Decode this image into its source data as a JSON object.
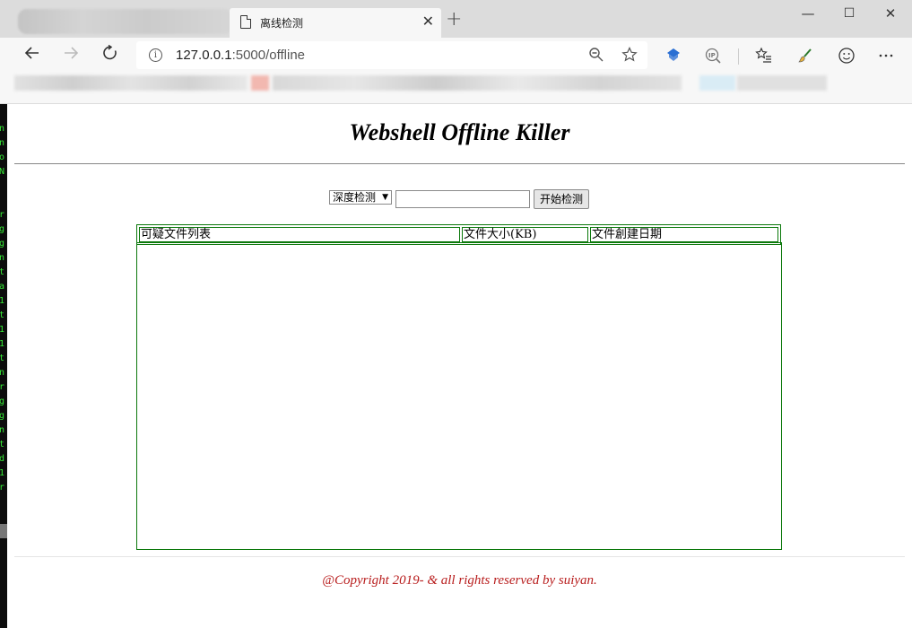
{
  "browser": {
    "active_tab_title": "离线检测",
    "tab_close_glyph": "✕",
    "new_tab_glyph": "+",
    "window_controls": {
      "minimize": "—",
      "maximize": "☐",
      "close": "✕"
    },
    "url_host": "127.0.0.1",
    "url_rest": ":5000/offline",
    "icons": {
      "back": "back-arrow-icon",
      "forward": "forward-arrow-icon",
      "refresh": "refresh-icon",
      "site_info": "info-icon",
      "zoom": "zoom-icon",
      "favorite": "star-icon",
      "favorites_list": "favorites-icon",
      "emoji": "smiley-icon",
      "more": "more-icon"
    }
  },
  "terminal_strip": {
    "lines": [
      "n",
      "n",
      "o",
      "N",
      "",
      "",
      "r",
      "g",
      "g",
      "n",
      "t",
      "a",
      "1",
      "t",
      "1",
      "1",
      "t",
      "n",
      "r",
      "g",
      "g",
      "n",
      "t",
      "d",
      "1",
      "r"
    ]
  },
  "page": {
    "title": "Webshell Offline Killer",
    "mode_select": {
      "selected": "深度检测"
    },
    "path_input": {
      "value": ""
    },
    "start_button": "开始检测",
    "table": {
      "columns": [
        "可疑文件列表",
        "文件大小(KB)",
        "文件創建日期"
      ],
      "rows": []
    },
    "footer": "@Copyright 2019- & all rights reserved by suiyan."
  },
  "colors": {
    "table_border": "#0b780b",
    "footer_text": "#b81c1c",
    "terminal_text": "#35e735"
  }
}
